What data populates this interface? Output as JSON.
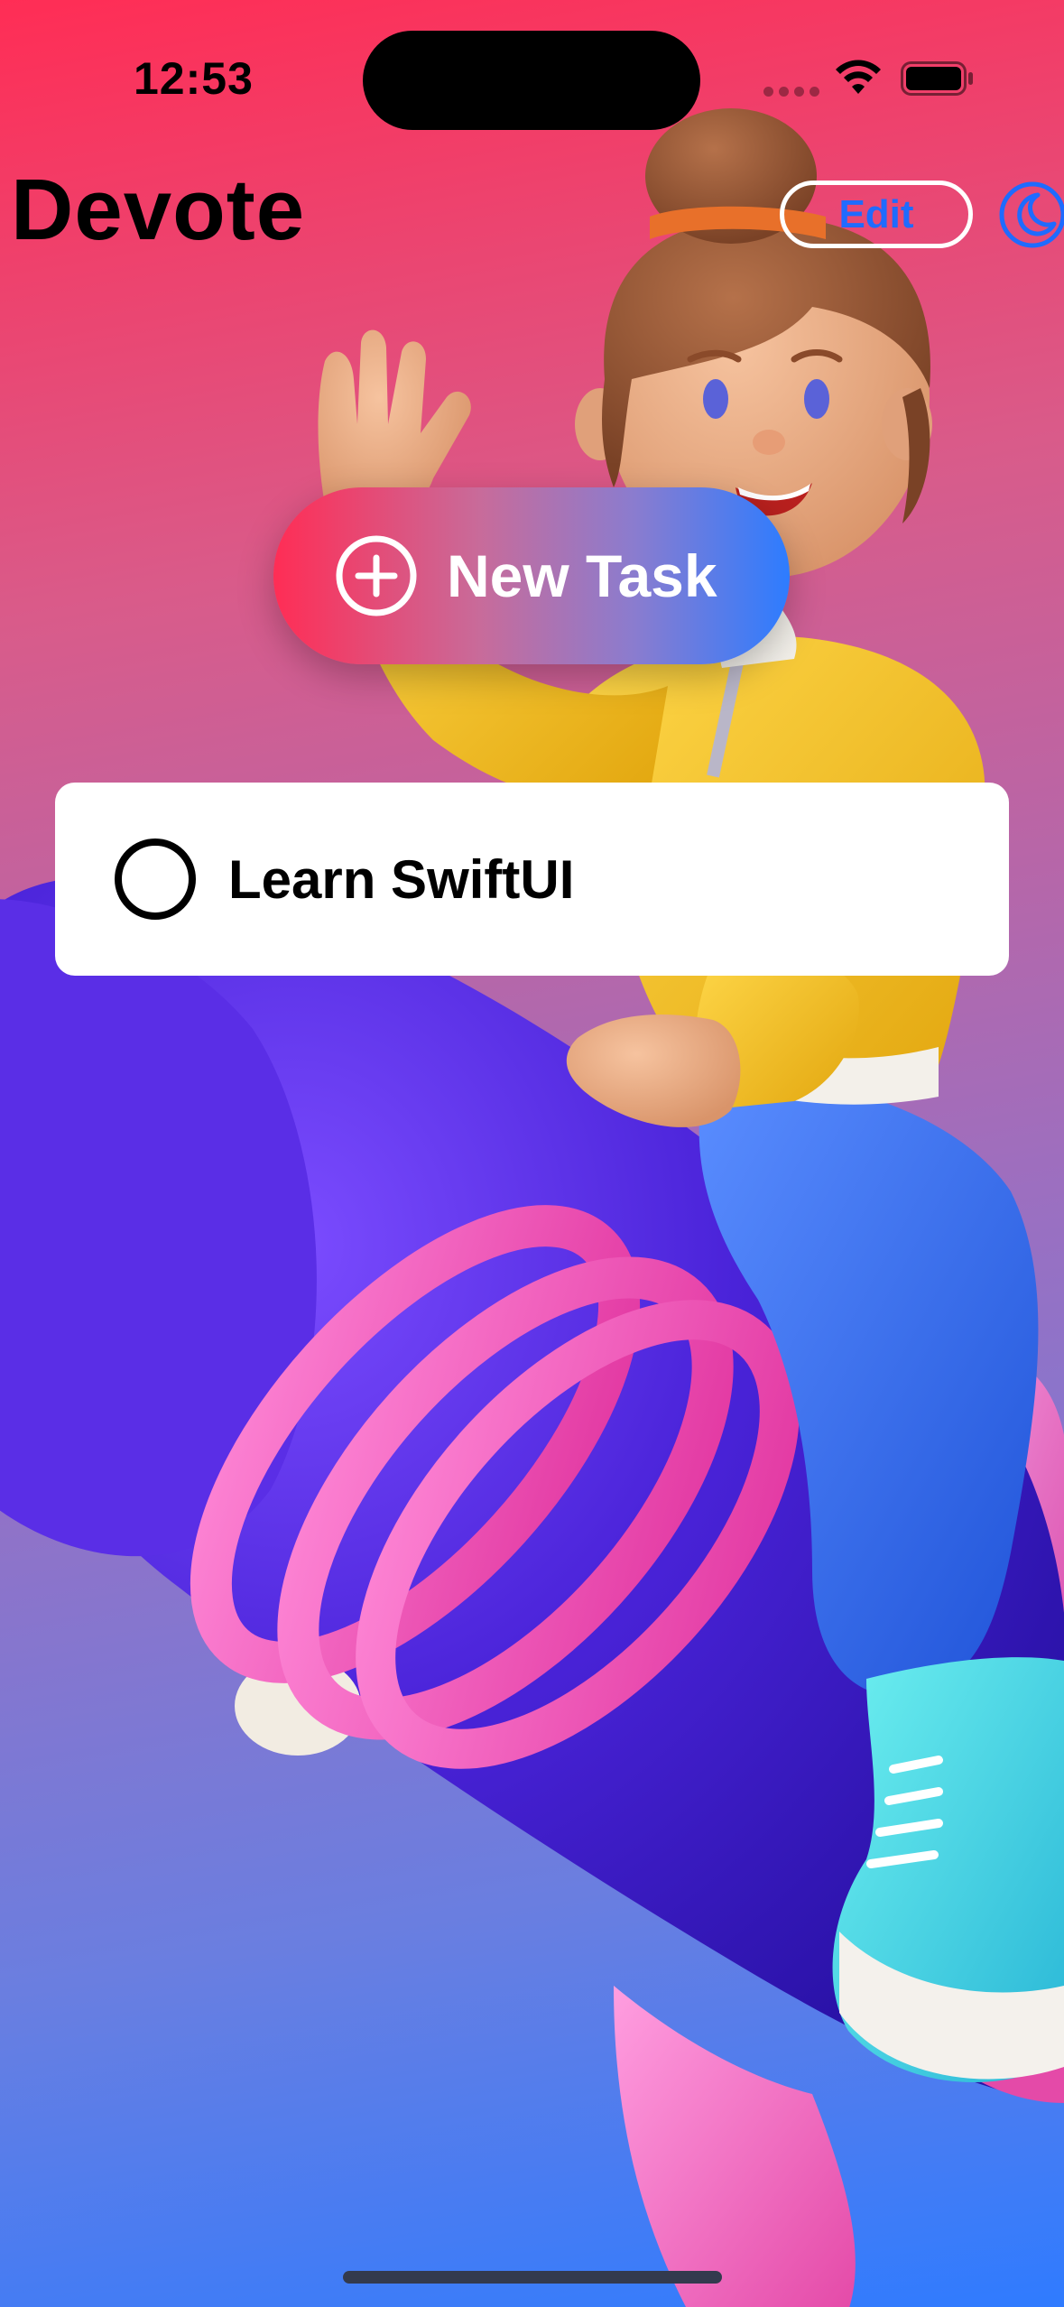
{
  "status_bar": {
    "time": "12:53"
  },
  "header": {
    "title": "Devote",
    "edit_label": "Edit",
    "theme_toggle_icon": "moon-circle-icon"
  },
  "new_task": {
    "label": "New Task",
    "icon": "plus-circle-icon"
  },
  "tasks": [
    {
      "title": "Learn SwiftUI",
      "completed": false
    }
  ],
  "colors": {
    "gradient_top": "#ff2d55",
    "gradient_bottom": "#2f7bff",
    "accent": "#1f6bff",
    "button_gradient_start": "#ff2d55",
    "button_gradient_end": "#2d7cff"
  }
}
